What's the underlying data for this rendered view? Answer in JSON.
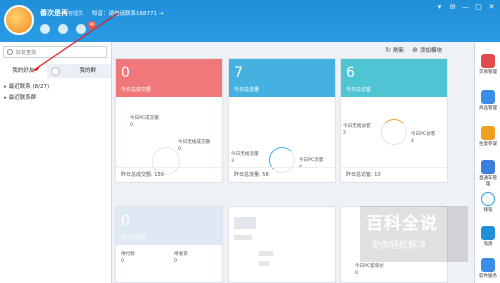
{
  "titlebar": {
    "app_name": "番次是再",
    "app_sub": "管理员",
    "status_text": "知音：请电话联系168771 →",
    "badge": "99",
    "controls": [
      "▾",
      "✉",
      "—",
      "□",
      "✕"
    ]
  },
  "left": {
    "search_placeholder": "好友查找",
    "tabs": [
      "我的好友",
      "我的群"
    ],
    "groups": [
      {
        "label": "最近联系 (8/27)"
      },
      {
        "label": "最近联系群"
      }
    ]
  },
  "actions": [
    {
      "icon": "refresh-icon",
      "glyph": "↻",
      "label": "刷新"
    },
    {
      "icon": "add-icon",
      "glyph": "⊕",
      "label": "添加模块"
    }
  ],
  "cards": [
    {
      "value": "0",
      "label": "今日总成交额",
      "color": "#f0787a",
      "stat_label": "今日PC成交额",
      "stat_value": "0",
      "stat2_label": "今日无线成交额",
      "stat2_value": "0",
      "footer": "昨日总成交额: 150"
    },
    {
      "value": "7",
      "label": "今日总流量",
      "color": "#45b1e0",
      "stat_label": "今日无线流量",
      "stat_value": "3",
      "stat2_label": "今日PC流量",
      "stat2_value": "4",
      "footer": "昨日总流量: 58"
    },
    {
      "value": "6",
      "label": "今日总访客",
      "color": "#4fc4d3",
      "stat_label": "今日无线访客",
      "stat_value": "2",
      "stat2_label": "今日PC访客",
      "stat2_value": "4",
      "footer": "昨日总访客: 10"
    },
    {
      "value": "0",
      "label": "今日订单数",
      "color": "#dfe8f3",
      "stat_label": "待付款",
      "stat_value": "0",
      "stat2_label": "待发货",
      "stat2_value": "0"
    },
    {
      "stat_label": "今日PC客单价",
      "stat_value": "0"
    }
  ],
  "rightbar": [
    {
      "label": "交易管理",
      "color": "#e24b4b"
    },
    {
      "label": "商品管理",
      "color": "#3a8ee6"
    },
    {
      "label": "生意参谋",
      "color": "#f0a020"
    },
    {
      "label": "直通车管理",
      "color": "#3a7fd9"
    },
    {
      "label": "钱笔",
      "color": "#2aa3e6"
    },
    {
      "label": "淘盘",
      "color": "#1f8fd8"
    },
    {
      "label": "软件服务",
      "color": "#3a8ee6"
    }
  ],
  "watermark": {
    "title": "百科全说",
    "subtitle": "助你轻松解决"
  }
}
